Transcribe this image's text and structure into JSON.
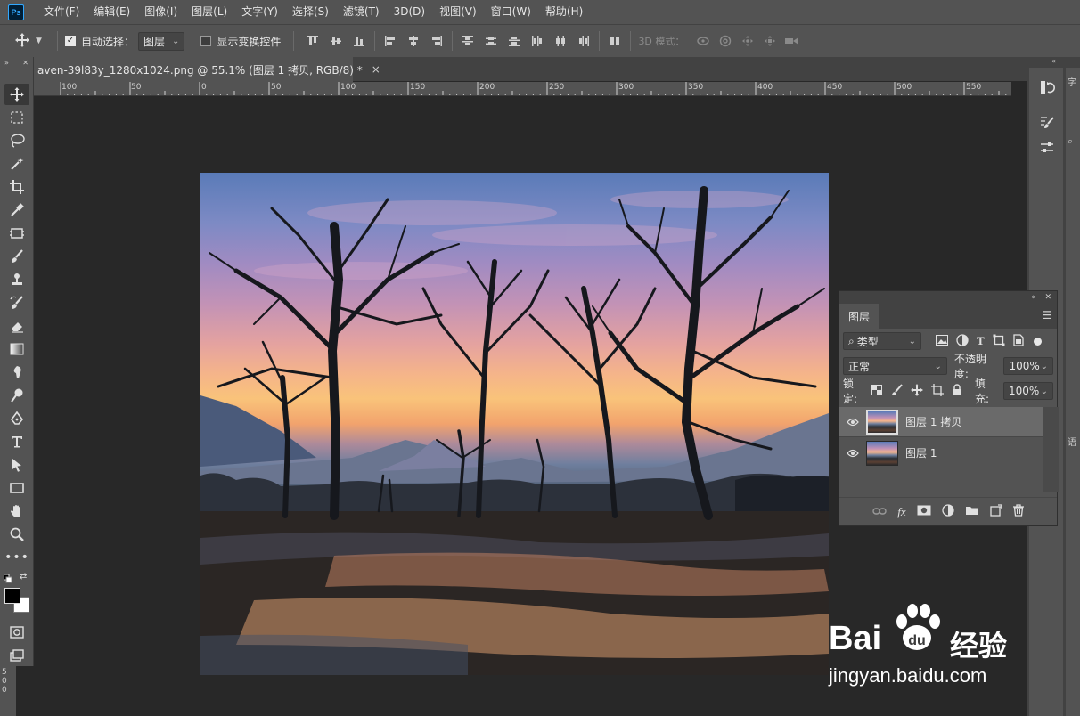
{
  "app": {
    "logo": "Ps"
  },
  "menu": [
    "文件(F)",
    "编辑(E)",
    "图像(I)",
    "图层(L)",
    "文字(Y)",
    "选择(S)",
    "滤镜(T)",
    "3D(D)",
    "视图(V)",
    "窗口(W)",
    "帮助(H)"
  ],
  "options": {
    "auto_select_label": "自动选择：",
    "auto_select_checked": true,
    "target_value": "图层",
    "show_transform_label": "显示变换控件",
    "show_transform_checked": false,
    "mode_3d_label": "3D 模式："
  },
  "document": {
    "tab_title": "aven-39l83y_1280x1024.png @ 55.1% (图层 1 拷贝, RGB/8) *",
    "close_glyph": "×"
  },
  "ruler": {
    "top_ticks": [
      "100",
      "50",
      "0",
      "50",
      "100",
      "150",
      "200",
      "250",
      "300",
      "350",
      "400",
      "450",
      "500",
      "550"
    ],
    "left_ticks": [
      "5",
      "0",
      "0"
    ]
  },
  "layers_panel": {
    "tab_label": "图层",
    "filter_kind": "类型",
    "blend_mode": "正常",
    "opacity_label": "不透明度:",
    "opacity_value": "100%",
    "lock_label": "锁定:",
    "fill_label": "填充:",
    "fill_value": "100%",
    "layers": [
      {
        "name": "图层 1 拷贝",
        "visible": true,
        "selected": true
      },
      {
        "name": "图层 1",
        "visible": true,
        "selected": false
      }
    ]
  },
  "watermark": {
    "brand": "Bai",
    "brand_suffix": "du",
    "cn_text": "经验",
    "url": "jingyan.baidu.com"
  },
  "dock_right": {
    "partial_label_1": "字",
    "partial_label_2": "语"
  }
}
